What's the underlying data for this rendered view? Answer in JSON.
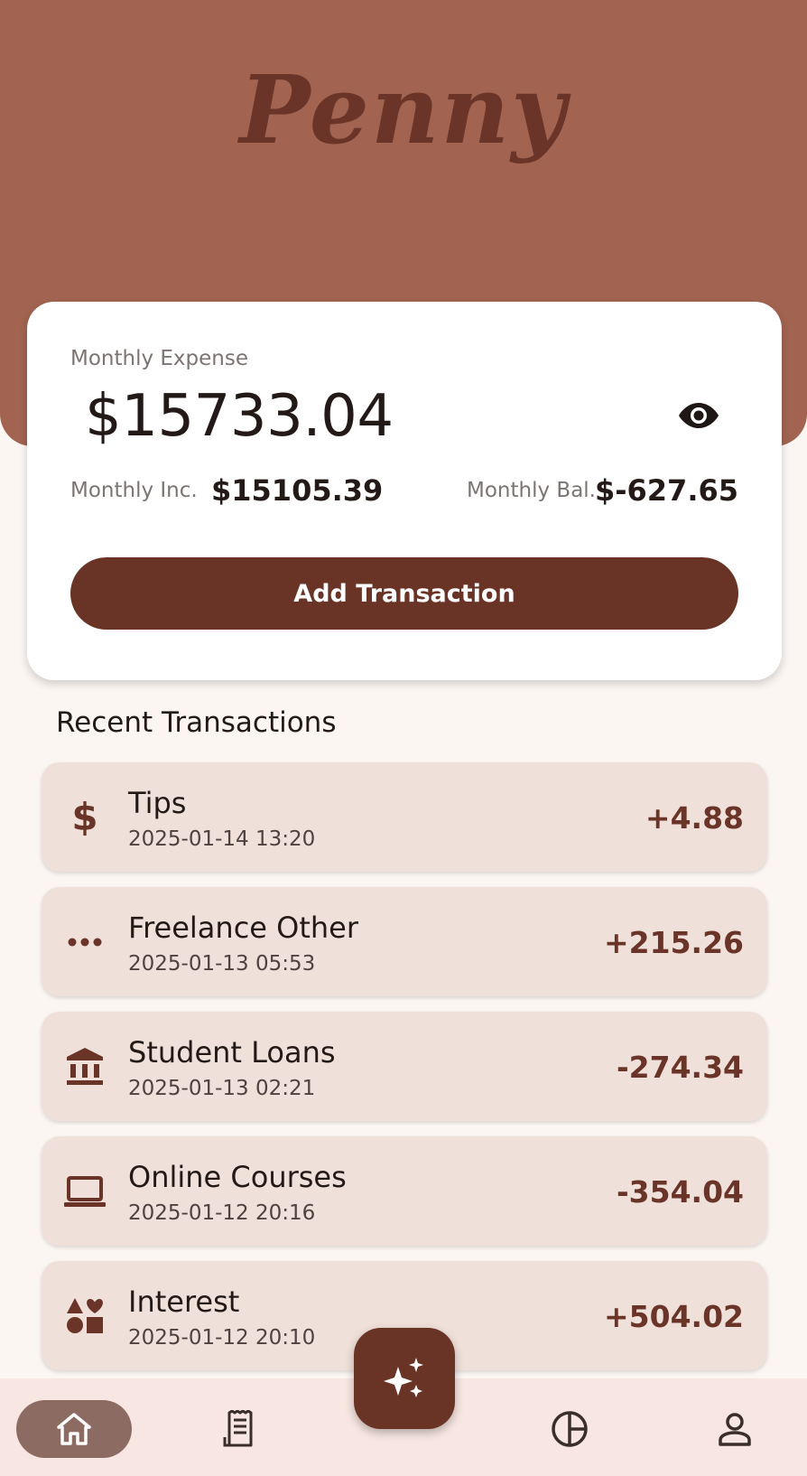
{
  "app": {
    "title": "Penny"
  },
  "summary": {
    "expense_label": "Monthly Expense",
    "expense_value": "$15733.04",
    "income_label": "Monthly Inc.",
    "income_value": "$15105.39",
    "balance_label": "Monthly Bal.",
    "balance_value": "$-627.65",
    "visibility_icon": "eye-icon",
    "add_button_label": "Add Transaction"
  },
  "recent": {
    "title": "Recent Transactions",
    "transactions": [
      {
        "name": "Tips",
        "date": "2025-01-14 13:20",
        "amount": "+4.88",
        "icon": "dollar-icon"
      },
      {
        "name": "Freelance Other",
        "date": "2025-01-13 05:53",
        "amount": "+215.26",
        "icon": "more-horiz-icon"
      },
      {
        "name": "Student Loans",
        "date": "2025-01-13 02:21",
        "amount": "-274.34",
        "icon": "bank-icon"
      },
      {
        "name": "Online Courses",
        "date": "2025-01-12 20:16",
        "amount": "-354.04",
        "icon": "laptop-icon"
      },
      {
        "name": "Interest",
        "date": "2025-01-12 20:10",
        "amount": "+504.02",
        "icon": "category-shapes-icon"
      }
    ]
  },
  "nav": {
    "items": [
      {
        "icon": "home-icon",
        "active": true
      },
      {
        "icon": "receipt-icon",
        "active": false
      },
      {
        "icon": "pie-chart-icon",
        "active": false
      },
      {
        "icon": "person-icon",
        "active": false
      }
    ],
    "fab_icon": "sparkle-icon"
  },
  "colors": {
    "header": "#a26451",
    "brand_dark": "#693426",
    "card_bg": "#f0e0da",
    "page_bg": "#fcf6f3",
    "nav_bg": "#f7e6e1",
    "nav_active": "#8c6b62"
  }
}
